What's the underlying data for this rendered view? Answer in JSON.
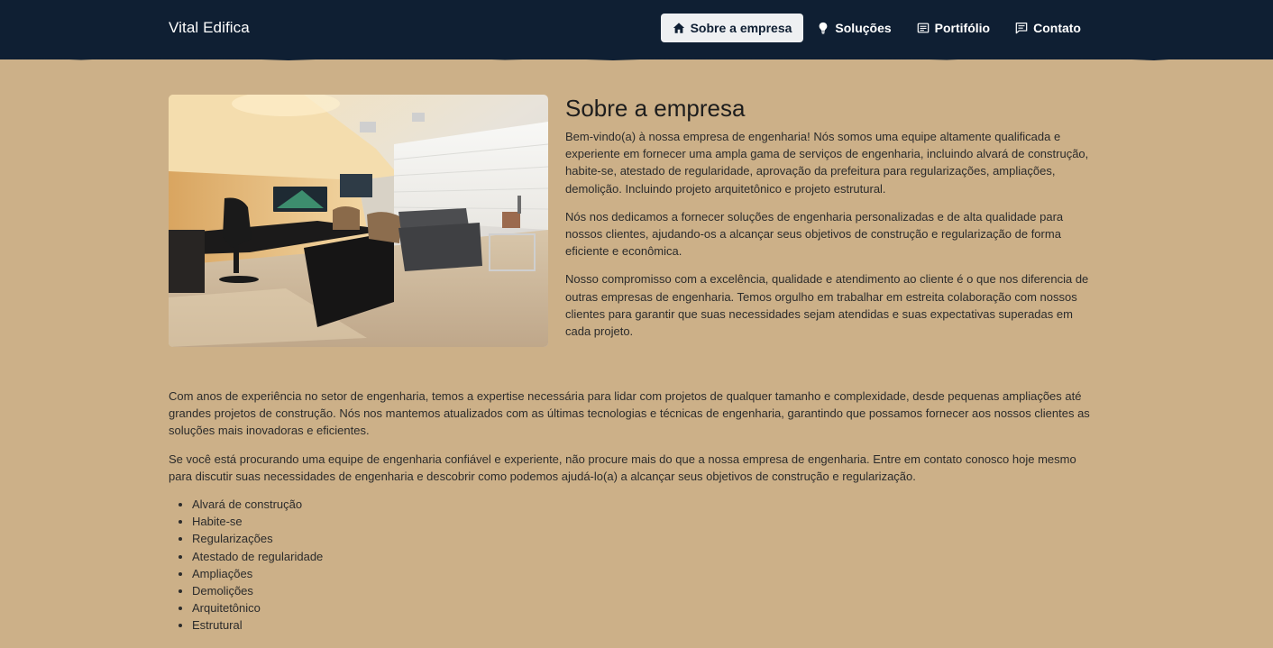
{
  "brand": "Vital Edifica",
  "nav": {
    "items": [
      {
        "label": "Sobre a empresa",
        "icon": "home-icon",
        "active": true
      },
      {
        "label": "Soluções",
        "icon": "lightbulb-icon",
        "active": false
      },
      {
        "label": "Portifólio",
        "icon": "document-icon",
        "active": false
      },
      {
        "label": "Contato",
        "icon": "chat-icon",
        "active": false
      }
    ]
  },
  "colors": {
    "navbar": "#0f1f33",
    "page_background": "#ccb088",
    "active_nav_background": "#eef0f2"
  },
  "about": {
    "title": "Sobre a empresa",
    "paragraphs": [
      "Bem-vindo(a) à nossa empresa de engenharia! Nós somos uma equipe altamente qualificada e experiente em fornecer uma ampla gama de serviços de engenharia, incluindo alvará de construção, habite-se, atestado de regularidade, aprovação da prefeitura para regularizações, ampliações, demolição. Incluindo projeto arquitetônico e projeto estrutural.",
      "Nós nos dedicamos a fornecer soluções de engenharia personalizadas e de alta qualidade para nossos clientes, ajudando-os a alcançar seus objetivos de construção e regularização de forma eficiente e econômica.",
      "Nosso compromisso com a excelência, qualidade e atendimento ao cliente é o que nos diferencia de outras empresas de engenharia. Temos orgulho em trabalhar em estreita colaboração com nossos clientes para garantir que suas necessidades sejam atendidas e suas expectativas superadas em cada projeto."
    ]
  },
  "more": {
    "paragraphs": [
      "Com anos de experiência no setor de engenharia, temos a expertise necessária para lidar com projetos de qualquer tamanho e complexidade, desde pequenas ampliações até grandes projetos de construção. Nós nos mantemos atualizados com as últimas tecnologias e técnicas de engenharia, garantindo que possamos fornecer aos nossos clientes as soluções mais inovadoras e eficientes.",
      "Se você está procurando uma equipe de engenharia confiável e experiente, não procure mais do que a nossa empresa de engenharia. Entre em contato conosco hoje mesmo para discutir suas necessidades de engenharia e descobrir como podemos ajudá-lo(a) a alcançar seus objetivos de construção e regularização."
    ],
    "services": [
      "Alvará de construção",
      "Habite-se",
      "Regularizações",
      "Atestado de regularidade",
      "Ampliações",
      "Demolições",
      "Arquitetônico",
      "Estrutural"
    ]
  }
}
